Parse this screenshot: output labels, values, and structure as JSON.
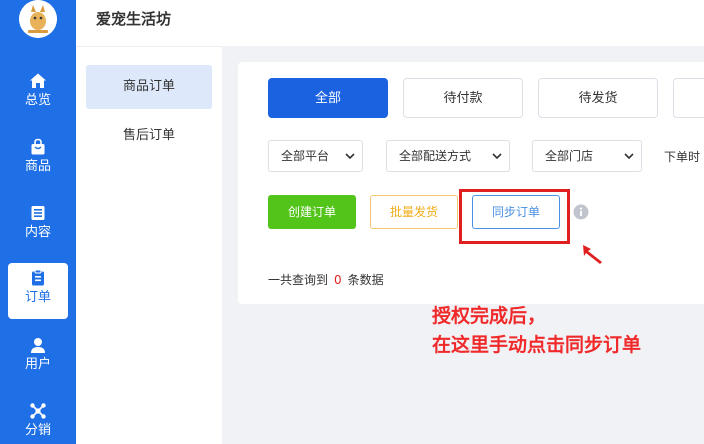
{
  "app": {
    "title": "爱宠生活坊"
  },
  "nav": {
    "items": [
      {
        "label": "总览",
        "icon": "home-icon"
      },
      {
        "label": "商品",
        "icon": "bag-icon"
      },
      {
        "label": "内容",
        "icon": "list-icon"
      },
      {
        "label": "订单",
        "icon": "clipboard-icon"
      },
      {
        "label": "用户",
        "icon": "user-icon"
      },
      {
        "label": "分销",
        "icon": "network-icon"
      }
    ],
    "active": "订单"
  },
  "subnav": {
    "items": [
      {
        "label": "商品订单"
      },
      {
        "label": "售后订单"
      }
    ],
    "active": "商品订单"
  },
  "tabs": [
    {
      "label": "全部"
    },
    {
      "label": "待付款"
    },
    {
      "label": "待发货"
    }
  ],
  "filters": {
    "platform": "全部平台",
    "delivery": "全部配送方式",
    "store": "全部门店",
    "order_time_label": "下单时"
  },
  "actions": {
    "create": "创建订单",
    "batch_ship": "批量发货",
    "sync": "同步订单"
  },
  "result": {
    "prefix": "一共查询到",
    "count": "0",
    "suffix": "条数据"
  },
  "annotation": {
    "line1": "授权完成后，",
    "line2": "在这里手动点击同步订单"
  },
  "colors": {
    "primary": "#1f6fe6",
    "success": "#52c41a",
    "warning": "#f0ad1a",
    "annotation": "#f02a2a"
  }
}
